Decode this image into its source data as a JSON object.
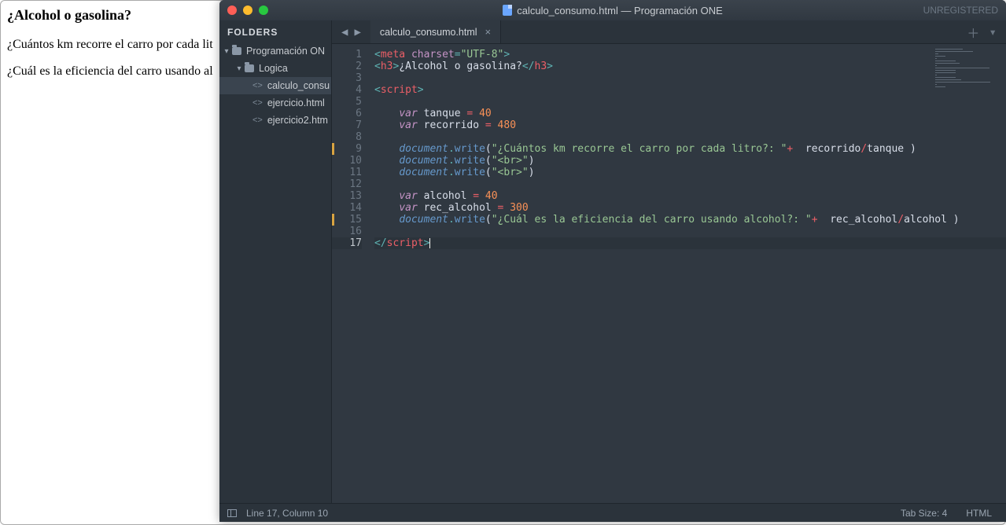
{
  "browser_page": {
    "heading": "¿Alcohol o gasolina?",
    "line1": "¿Cuántos km recorre el carro por cada lit",
    "line2": "¿Cuál es la eficiencia del carro usando al"
  },
  "titlebar": {
    "title": "calculo_consumo.html — Programación ONE",
    "right_label": "UNREGISTERED"
  },
  "sidebar": {
    "header": "FOLDERS",
    "items": [
      {
        "kind": "folder",
        "indent": 0,
        "open": true,
        "label": "Programación ON"
      },
      {
        "kind": "folder",
        "indent": 1,
        "open": true,
        "label": "Logica"
      },
      {
        "kind": "file",
        "indent": 2,
        "selected": true,
        "label": "calculo_consu"
      },
      {
        "kind": "file",
        "indent": 2,
        "selected": false,
        "label": "ejercicio.html"
      },
      {
        "kind": "file",
        "indent": 2,
        "selected": false,
        "label": "ejercicio2.htm"
      }
    ]
  },
  "tabbar": {
    "nav_back": "◀",
    "nav_fwd": "▶",
    "tab_label": "calculo_consumo.html",
    "tab_close": "×",
    "add": "＋",
    "menu": "▾"
  },
  "code": {
    "line_count": 17,
    "current_line": 17,
    "marked_lines": [
      9,
      15
    ],
    "tokens": [
      [
        {
          "t": "<",
          "c": "p-cyan"
        },
        {
          "t": "meta",
          "c": "p-red"
        },
        {
          "t": " ",
          "c": ""
        },
        {
          "t": "charset",
          "c": "p-purple"
        },
        {
          "t": "=",
          "c": "p-cyan"
        },
        {
          "t": "\"UTF-8\"",
          "c": "p-green"
        },
        {
          "t": ">",
          "c": "p-cyan"
        }
      ],
      [
        {
          "t": "<",
          "c": "p-cyan"
        },
        {
          "t": "h3",
          "c": "p-red"
        },
        {
          "t": ">",
          "c": "p-cyan"
        },
        {
          "t": "¿Alcohol o gasolina?",
          "c": "p-white"
        },
        {
          "t": "</",
          "c": "p-cyan"
        },
        {
          "t": "h3",
          "c": "p-red"
        },
        {
          "t": ">",
          "c": "p-cyan"
        }
      ],
      [],
      [
        {
          "t": "<",
          "c": "p-cyan"
        },
        {
          "t": "script",
          "c": "p-red"
        },
        {
          "t": ">",
          "c": "p-cyan"
        }
      ],
      [],
      [
        {
          "t": "    ",
          "c": ""
        },
        {
          "t": "var",
          "c": "p-purple p-italic"
        },
        {
          "t": " tanque ",
          "c": "p-white"
        },
        {
          "t": "=",
          "c": "p-red"
        },
        {
          "t": " ",
          "c": ""
        },
        {
          "t": "40",
          "c": "p-orange"
        }
      ],
      [
        {
          "t": "    ",
          "c": ""
        },
        {
          "t": "var",
          "c": "p-purple p-italic"
        },
        {
          "t": " recorrido ",
          "c": "p-white"
        },
        {
          "t": "=",
          "c": "p-red"
        },
        {
          "t": " ",
          "c": ""
        },
        {
          "t": "480",
          "c": "p-orange"
        }
      ],
      [],
      [
        {
          "t": "    ",
          "c": ""
        },
        {
          "t": "document",
          "c": "p-blue p-italic"
        },
        {
          "t": ".",
          "c": "p-cyan"
        },
        {
          "t": "write",
          "c": "p-blue"
        },
        {
          "t": "(",
          "c": "p-white"
        },
        {
          "t": "\"¿Cuántos km recorre el carro por cada litro?: \"",
          "c": "p-green"
        },
        {
          "t": "+",
          "c": "p-red"
        },
        {
          "t": "  recorrido",
          "c": "p-white"
        },
        {
          "t": "/",
          "c": "p-red"
        },
        {
          "t": "tanque",
          "c": "p-white"
        },
        {
          "t": " )",
          "c": "p-white"
        }
      ],
      [
        {
          "t": "    ",
          "c": ""
        },
        {
          "t": "document",
          "c": "p-blue p-italic"
        },
        {
          "t": ".",
          "c": "p-cyan"
        },
        {
          "t": "write",
          "c": "p-blue"
        },
        {
          "t": "(",
          "c": "p-white"
        },
        {
          "t": "\"<br>\"",
          "c": "p-green"
        },
        {
          "t": ")",
          "c": "p-white"
        }
      ],
      [
        {
          "t": "    ",
          "c": ""
        },
        {
          "t": "document",
          "c": "p-blue p-italic"
        },
        {
          "t": ".",
          "c": "p-cyan"
        },
        {
          "t": "write",
          "c": "p-blue"
        },
        {
          "t": "(",
          "c": "p-white"
        },
        {
          "t": "\"<br>\"",
          "c": "p-green"
        },
        {
          "t": ")",
          "c": "p-white"
        }
      ],
      [],
      [
        {
          "t": "    ",
          "c": ""
        },
        {
          "t": "var",
          "c": "p-purple p-italic"
        },
        {
          "t": " alcohol ",
          "c": "p-white"
        },
        {
          "t": "=",
          "c": "p-red"
        },
        {
          "t": " ",
          "c": ""
        },
        {
          "t": "40",
          "c": "p-orange"
        }
      ],
      [
        {
          "t": "    ",
          "c": ""
        },
        {
          "t": "var",
          "c": "p-purple p-italic"
        },
        {
          "t": " rec_alcohol ",
          "c": "p-white"
        },
        {
          "t": "=",
          "c": "p-red"
        },
        {
          "t": " ",
          "c": ""
        },
        {
          "t": "300",
          "c": "p-orange"
        }
      ],
      [
        {
          "t": "    ",
          "c": ""
        },
        {
          "t": "document",
          "c": "p-blue p-italic"
        },
        {
          "t": ".",
          "c": "p-cyan"
        },
        {
          "t": "write",
          "c": "p-blue"
        },
        {
          "t": "(",
          "c": "p-white"
        },
        {
          "t": "\"¿Cuál es la eficiencia del carro usando alcohol?: \"",
          "c": "p-green"
        },
        {
          "t": "+",
          "c": "p-red"
        },
        {
          "t": "  rec_alcohol",
          "c": "p-white"
        },
        {
          "t": "/",
          "c": "p-red"
        },
        {
          "t": "alcohol",
          "c": "p-white"
        },
        {
          "t": " )",
          "c": "p-white"
        }
      ],
      [],
      [
        {
          "t": "</",
          "c": "p-cyan"
        },
        {
          "t": "script",
          "c": "p-red"
        },
        {
          "t": ">",
          "c": "p-cyan"
        }
      ]
    ]
  },
  "statusbar": {
    "cursor": "Line 17, Column 10",
    "tabsize": "Tab Size: 4",
    "lang": "HTML"
  }
}
